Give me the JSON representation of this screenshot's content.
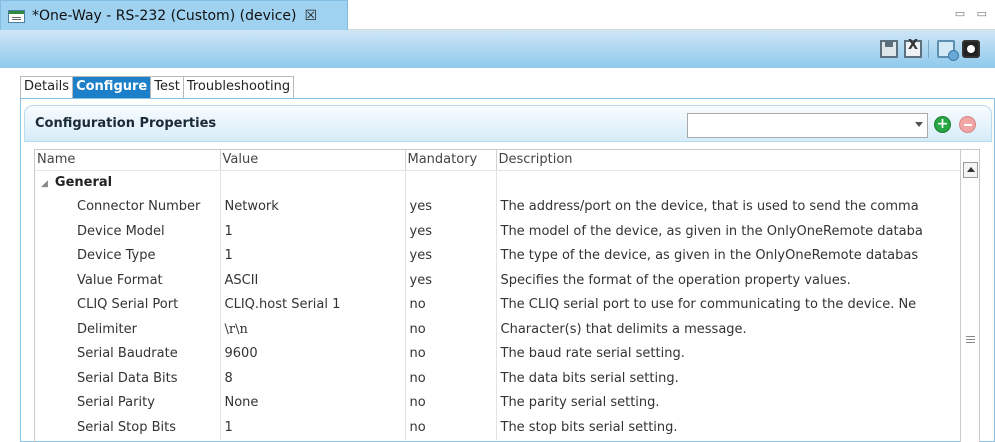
{
  "editor_tab": {
    "title": "*One-Way - RS-232 (Custom) (device)",
    "close_glyph": "☒",
    "icon": "device-icon"
  },
  "window_controls": {
    "glyphs": "▭ ▭",
    "icons": [
      "minimize-icon",
      "maximize-icon"
    ]
  },
  "toolbar": {
    "icons": [
      "save-icon",
      "save-all-icon",
      "refresh-icon",
      "monitor-icon"
    ],
    "save_all_mark": "X"
  },
  "subtabs": [
    {
      "label": "Details",
      "active": false
    },
    {
      "label": "Configure",
      "active": true
    },
    {
      "label": "Test",
      "active": false
    },
    {
      "label": "Troubleshooting",
      "active": false
    }
  ],
  "section": {
    "title": "Configuration Properties",
    "combo_value": "",
    "add_glyph": "+",
    "icons": [
      "add-icon",
      "remove-icon",
      "dropdown-arrow-icon"
    ]
  },
  "table": {
    "columns": [
      "Name",
      "Value",
      "Mandatory",
      "Description"
    ],
    "group": "General",
    "group_glyph": "◢",
    "rows": [
      {
        "name": "Connector Number",
        "value": "Network",
        "mandatory": "yes",
        "description": "The address/port on the device, that is used to send the comma"
      },
      {
        "name": "Device Model",
        "value": "1",
        "mandatory": "yes",
        "description": "The model of the device, as given in the OnlyOneRemote databa"
      },
      {
        "name": "Device Type",
        "value": "1",
        "mandatory": "yes",
        "description": "The type of the device, as given in the OnlyOneRemote databas"
      },
      {
        "name": "Value Format",
        "value": "ASCII",
        "mandatory": "yes",
        "description": "Specifies the format of the operation property values."
      },
      {
        "name": "CLIQ Serial Port",
        "value": "CLIQ.host Serial 1",
        "mandatory": "no",
        "description": "The CLIQ serial port to use for communicating to the device. Ne"
      },
      {
        "name": "Delimiter",
        "value": "\\r\\n",
        "mandatory": "no",
        "description": "Character(s) that delimits a message."
      },
      {
        "name": "Serial Baudrate",
        "value": "9600",
        "mandatory": "no",
        "description": "The baud rate serial setting."
      },
      {
        "name": "Serial Data Bits",
        "value": "8",
        "mandatory": "no",
        "description": "The data bits serial setting."
      },
      {
        "name": "Serial Parity",
        "value": "None",
        "mandatory": "no",
        "description": "The parity serial setting."
      },
      {
        "name": "Serial Stop Bits",
        "value": "1",
        "mandatory": "no",
        "description": "The stop bits serial setting."
      }
    ]
  },
  "colors": {
    "tab_active": "#9fd1f0",
    "header_gradient_end": "#8fc9ec",
    "subtab_active": "#1b7fc9",
    "add_green": "#28a745",
    "remove_red": "#f1a6a6"
  }
}
